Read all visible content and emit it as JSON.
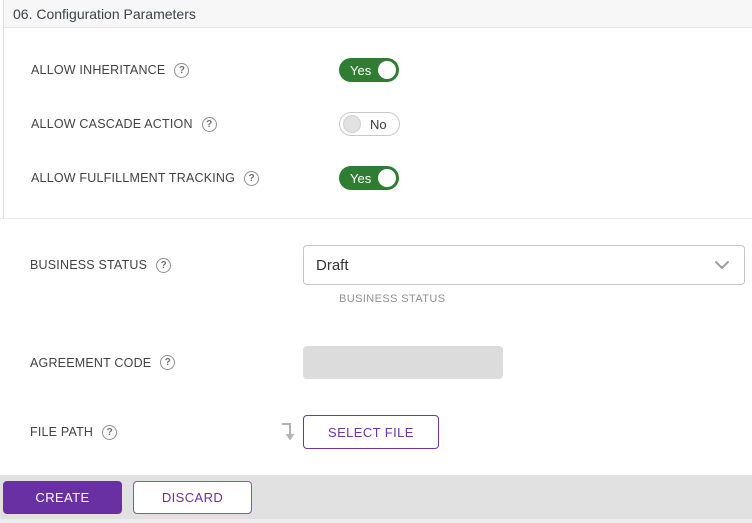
{
  "panel": {
    "title": "06. Configuration Parameters"
  },
  "help_glyph": "?",
  "toggles": [
    {
      "label": "ALLOW INHERITANCE",
      "value": "Yes",
      "state": "on"
    },
    {
      "label": "ALLOW CASCADE ACTION",
      "value": "No",
      "state": "off"
    },
    {
      "label": "ALLOW FULFILLMENT TRACKING",
      "value": "Yes",
      "state": "on"
    }
  ],
  "business_status": {
    "label": "BUSINESS STATUS",
    "selected": "Draft",
    "helper_label": "BUSINESS STATUS"
  },
  "agreement_code": {
    "label": "AGREEMENT CODE",
    "value": ""
  },
  "file_path": {
    "label": "FILE PATH",
    "button": "SELECT FILE"
  },
  "footer": {
    "create": "CREATE",
    "discard": "DISCARD"
  },
  "colors": {
    "toggle_on_green": "#2e7d32",
    "accent_purple": "#6930a3",
    "footer_bg": "#e1e1e1"
  }
}
